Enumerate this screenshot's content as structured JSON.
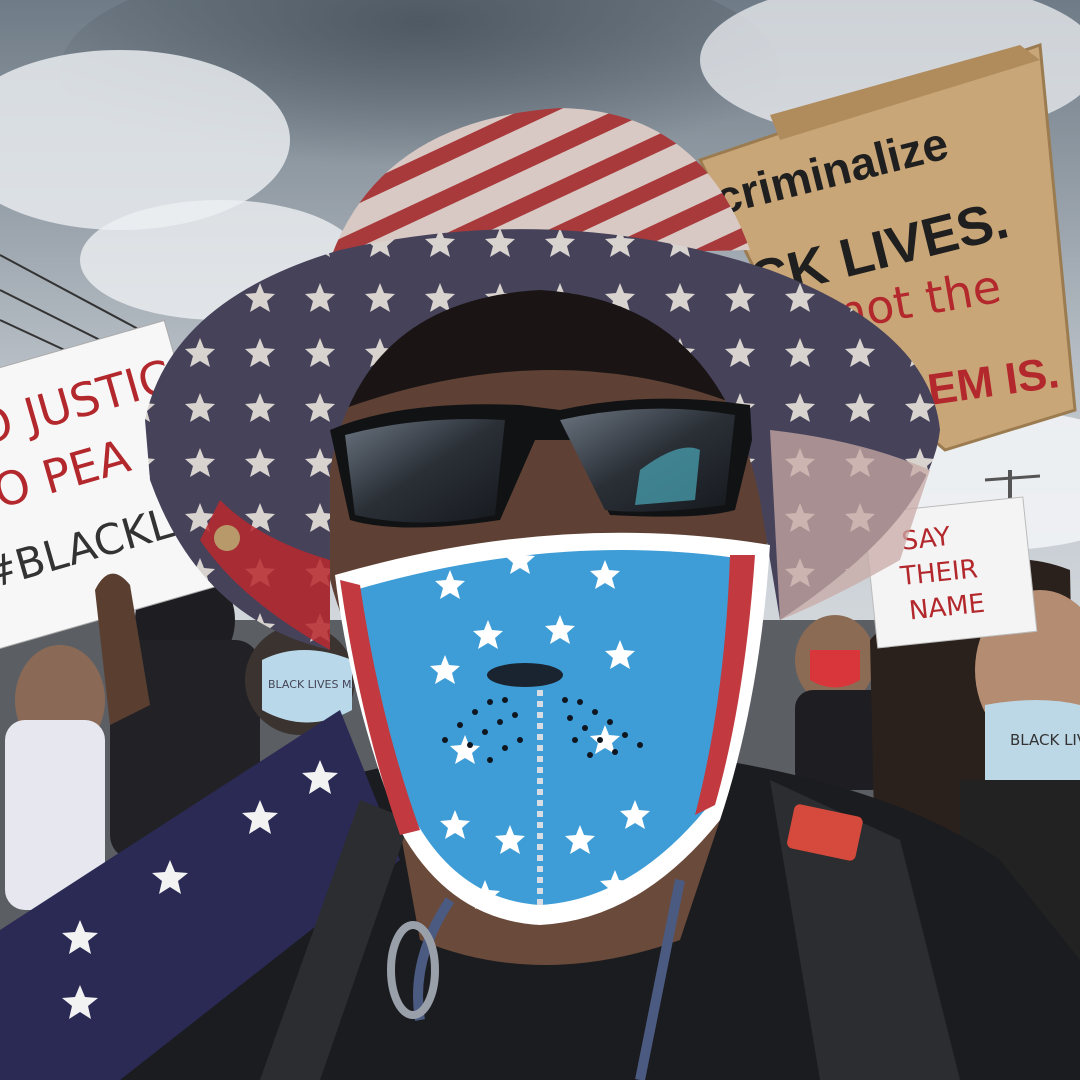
{
  "photo": {
    "subject": "selfie-protester",
    "signs": {
      "right_sign": {
        "line1": "criminalize",
        "line2": "CK LIVES.",
        "line3": "not the",
        "line4": "EM IS."
      },
      "left_sign": {
        "line1": "NO JUSTIC",
        "line2": "NO PEA",
        "line3": "#BLACKLIVE"
      },
      "back_sign": {
        "line1": "SAY",
        "line2": "THEIR",
        "line3": "NAME"
      },
      "mask_text_right": "BLACK LIVE",
      "mask_text_left": "BLACK LIVES MATTE"
    },
    "colors": {
      "sky": "#c9ced3",
      "cloud_dark": "#5c6670",
      "cardboard": "#c9a677",
      "flag_red": "#b8282e",
      "flag_blue": "#3e9dd6",
      "navy": "#2a2a55",
      "ink_dark": "#1f1f1f",
      "ink_red": "#b3282c"
    }
  }
}
